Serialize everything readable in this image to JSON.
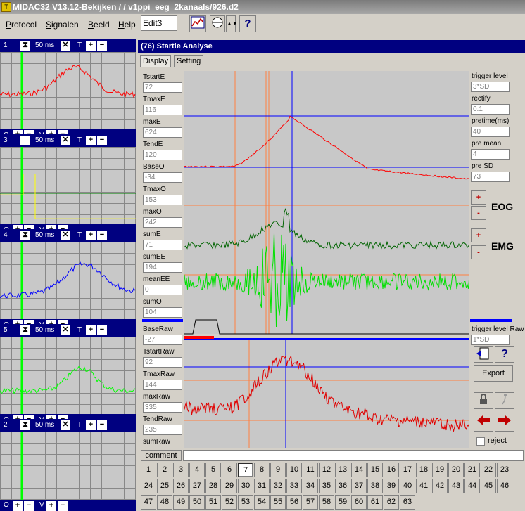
{
  "window_title": "MIDAC32 V13.12-Bekijken /  / v1ppi_eeg_2kanaals/926.d2",
  "app_icon_letter": "T",
  "menu": [
    "Protocol",
    "Signalen",
    "Beeld",
    "Help"
  ],
  "menu_shortcuts": [
    "P",
    "S",
    "B",
    "H"
  ],
  "edit_field": "Edit3",
  "toolbar_help": "?",
  "channels": [
    {
      "id": "1",
      "time": "50 ms",
      "color": "#ff0000"
    },
    {
      "id": "3",
      "time": "50 ms",
      "color": "#ffff00"
    },
    {
      "id": "4",
      "time": "50 ms",
      "color": "#0000ff"
    },
    {
      "id": "5",
      "time": "50 ms",
      "color": "#00ff00"
    },
    {
      "id": "2",
      "time": "50 ms",
      "color": "#000000"
    }
  ],
  "ch_foot": {
    "o": "O",
    "v": "V",
    "t": "T"
  },
  "panel_title": "(76) Startle Analyse",
  "tabs": [
    "Display",
    "Setting"
  ],
  "left_fields": [
    {
      "label": "TstartE",
      "value": "72"
    },
    {
      "label": "TmaxE",
      "value": "116"
    },
    {
      "label": "maxE",
      "value": "624"
    },
    {
      "label": "TendE",
      "value": "120"
    },
    {
      "label": "BaseO",
      "value": "-34"
    },
    {
      "label": "TmaxO",
      "value": "153"
    },
    {
      "label": "maxO",
      "value": "242"
    },
    {
      "label": "sumE",
      "value": "71"
    },
    {
      "label": "sumEE",
      "value": "194"
    },
    {
      "label": "meanEE",
      "value": "0"
    },
    {
      "label": "sumO",
      "value": "104"
    }
  ],
  "left_fields_raw": [
    {
      "label": "BaseRaw",
      "value": "-27"
    },
    {
      "label": "TstartRaw",
      "value": "92"
    },
    {
      "label": "TmaxRaw",
      "value": "144"
    },
    {
      "label": "maxRaw",
      "value": "335"
    },
    {
      "label": "TendRaw",
      "value": "235"
    },
    {
      "label": "sumRaw",
      "value": ""
    }
  ],
  "right_fields": [
    {
      "label": "trigger level",
      "value": "3*SD"
    },
    {
      "label": "rectify",
      "value": "0.1"
    },
    {
      "label": "pretime(ms)",
      "value": "40"
    },
    {
      "label": "pre mean",
      "value": "4"
    },
    {
      "label": "pre  SD",
      "value": "73"
    }
  ],
  "eog_label": "EOG",
  "emg_label": "EMG",
  "plus": "+",
  "minus": "-",
  "trigger_raw_label": "trigger level Raw",
  "trigger_raw_value": "1*SD",
  "export_label": "Export",
  "reject_label": "reject",
  "comment_label": "comment",
  "comment_value": "",
  "trial_numbers": [
    "1",
    "2",
    "3",
    "4",
    "5",
    "6",
    "7",
    "8",
    "9",
    "10",
    "11",
    "12",
    "13",
    "14",
    "15",
    "16",
    "17",
    "18",
    "19",
    "20",
    "21",
    "22",
    "23",
    "24",
    "25",
    "26",
    "27",
    "28",
    "29",
    "30",
    "31",
    "32",
    "33",
    "34",
    "35",
    "36",
    "37",
    "38",
    "39",
    "40",
    "41",
    "42",
    "43",
    "44",
    "45",
    "46",
    "47",
    "48",
    "49",
    "50",
    "51",
    "52",
    "53",
    "54",
    "55",
    "56",
    "57",
    "58",
    "59",
    "60",
    "61",
    "62",
    "63"
  ],
  "selected_trial": "7"
}
